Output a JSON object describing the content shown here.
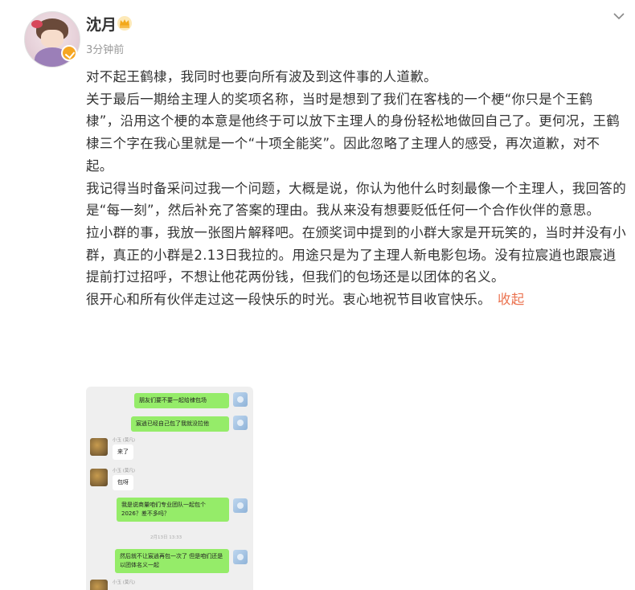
{
  "post": {
    "username": "沈月",
    "time": "3分钟前",
    "paragraphs": [
      "对不起王鹤棣，我同时也要向所有波及到这件事的人道歉。",
      "关于最后一期给主理人的奖项名称，当时是想到了我们在客栈的一个梗“你只是个王鹤棣”，沿用这个梗的本意是他终于可以放下主理人的身份轻松地做回自己了。更何况，王鹤棣三个字在我心里就是一个“十项全能奖”。因此忽略了主理人的感受，再次道歉，对不起。",
      "我记得当时备采问过我一个问题，大概是说，你认为他什么时刻最像一个主理人，我回答的是“每一刻”，然后补充了答案的理由。我从来没有想要贬低任何一个合作伙伴的意思。",
      "拉小群的事，我放一张图片解释吧。在颁奖词中提到的小群大家是开玩笑的，当时并没有小群，真正的小群是2.13日我拉的。用途只是为了主理人新电影包场。没有拉宸逍也跟宸逍提前打过招呼，不想让他花两份钱，但我们的包场还是以团体的名义。",
      "很开心和所有伙伴走过这一段快乐的时光。衷心地祝节目收官快乐。"
    ],
    "collapse_label": "收起"
  },
  "icons": {
    "avatar": "user-avatar",
    "verified": "verified-badge-icon",
    "crown": "crown-icon",
    "more": "chevron-down-icon"
  },
  "colors": {
    "link": "#eb7350",
    "chat_bubble_right": "#95ec69",
    "badge": "#f5a623"
  },
  "chat": {
    "messages": [
      {
        "side": "right",
        "text": "朋友们要不要一起给棣包场"
      },
      {
        "side": "right",
        "text": "宸逍已经自己包了我就没拉他"
      },
      {
        "side": "left",
        "nick": "小玉 (莫凡)",
        "text": "来了"
      },
      {
        "side": "left",
        "nick": "小玉 (莫凡)",
        "text": "包呀"
      },
      {
        "side": "right",
        "text": "我是说商量咱们专业团队一起包个2026？差不多吗？"
      },
      {
        "side": "time",
        "text": "2月13日 13:33"
      },
      {
        "side": "right",
        "text": "然后就不让宸逍再包一次了 但是咱们还是以团体名义一起"
      },
      {
        "side": "left",
        "nick": "小玉 (莫凡)",
        "text": ""
      }
    ]
  }
}
